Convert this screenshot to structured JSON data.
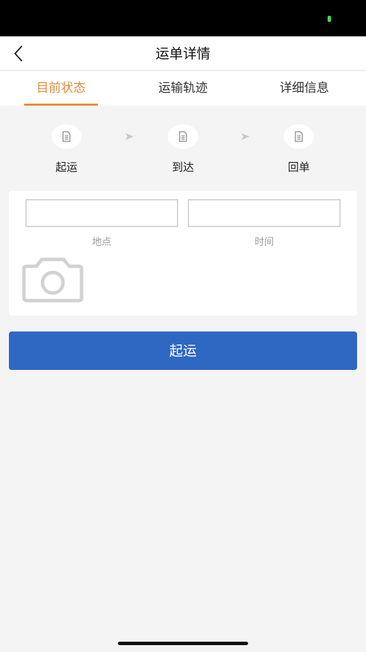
{
  "nav": {
    "title": "运单详情",
    "back_icon": "chevron-left-icon"
  },
  "tabs": [
    {
      "label": "目前状态",
      "active": true
    },
    {
      "label": "运输轨迹",
      "active": false
    },
    {
      "label": "详细信息",
      "active": false
    }
  ],
  "steps": [
    {
      "label": "起运",
      "icon": "document-icon"
    },
    {
      "label": "到达",
      "icon": "document-icon"
    },
    {
      "label": "回单",
      "icon": "document-icon"
    }
  ],
  "form": {
    "location": {
      "label": "地点",
      "value": "",
      "placeholder": ""
    },
    "time": {
      "label": "时间",
      "value": "",
      "placeholder": ""
    },
    "photo_icon": "camera-icon"
  },
  "primary_button": {
    "label": "起运"
  },
  "colors": {
    "accent": "#e88a3a",
    "primary": "#2e68c3",
    "background": "#f4f4f4"
  }
}
